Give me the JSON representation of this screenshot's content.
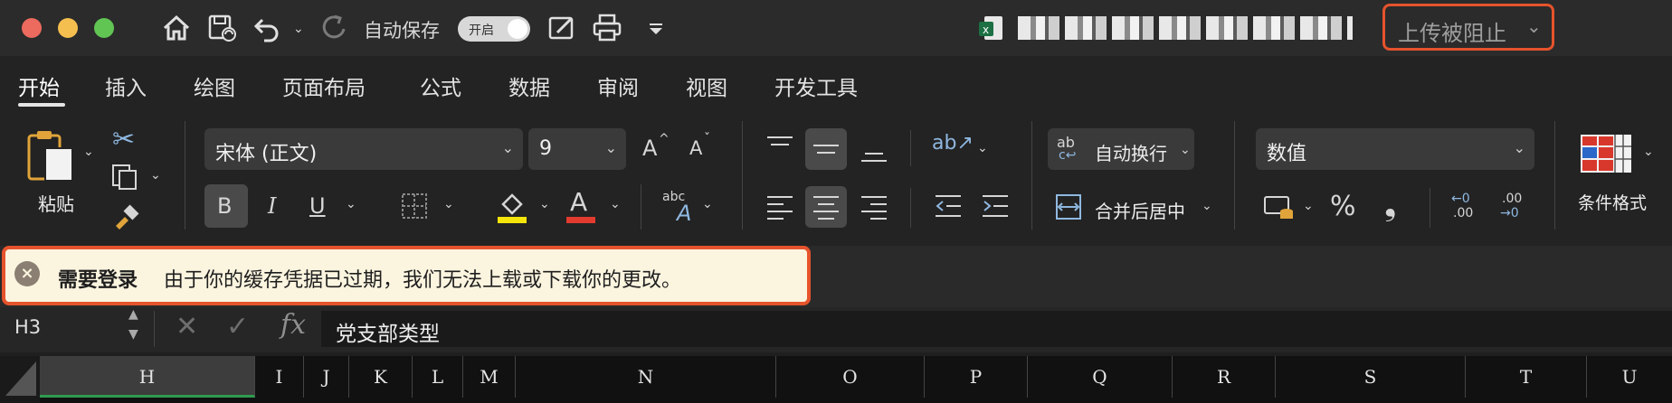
{
  "titlebar": {
    "autosave_label": "自动保存",
    "toggle_label": "开启",
    "upload_status": "上传被阻止",
    "colors": {
      "close": "#ed6a5e",
      "minimize": "#f5bf4f",
      "zoom": "#61c554",
      "highlight_border": "#e5532c"
    }
  },
  "tabs": [
    {
      "label": "开始",
      "active": true
    },
    {
      "label": "插入"
    },
    {
      "label": "绘图"
    },
    {
      "label": "页面布局"
    },
    {
      "label": "公式"
    },
    {
      "label": "数据"
    },
    {
      "label": "审阅"
    },
    {
      "label": "视图"
    },
    {
      "label": "开发工具"
    }
  ],
  "ribbon": {
    "paste_label": "粘贴",
    "font_name": "宋体 (正文)",
    "font_size": "9",
    "bold": "B",
    "italic": "I",
    "underline": "U",
    "grow_font": "A",
    "shrink_font": "A",
    "font_color_letter": "A",
    "abc": "abc",
    "wrap_abc": "ab",
    "wrap_label": "自动换行",
    "merge_label": "合并后居中",
    "number_format": "数值",
    "percent": "%",
    "comma": "❟",
    "inc_decimal_top": "←0",
    "inc_decimal_bottom": ".00",
    "dec_decimal_top": ".00",
    "dec_decimal_bottom": "→0",
    "conditional_format_label": "条件格式",
    "colors": {
      "highlight": "#f5e50a",
      "font_color": "#e23b2e"
    }
  },
  "notification": {
    "title": "需要登录",
    "message": "由于你的缓存凭据已过期，我们无法上载或下载你的更改。"
  },
  "formula_bar": {
    "cell_ref": "H3",
    "fx": "fx",
    "value": "党支部类型"
  },
  "columns": [
    "H",
    "I",
    "J",
    "K",
    "L",
    "M",
    "N",
    "O",
    "P",
    "Q",
    "R",
    "S",
    "T",
    "U"
  ]
}
